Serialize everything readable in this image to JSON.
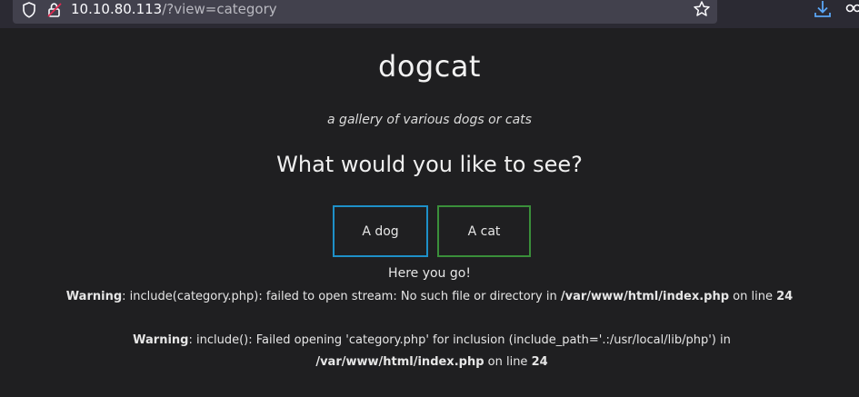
{
  "browser": {
    "url_host": "10.10.80.113",
    "url_path": "/?view=category"
  },
  "page": {
    "title": "dogcat",
    "subtitle": "a gallery of various dogs or cats",
    "question": "What would you like to see?",
    "buttons": {
      "dog": "A dog",
      "cat": "A cat"
    },
    "result_text": "Here you go!",
    "warnings": [
      {
        "label": "Warning",
        "message": ": include(category.php): failed to open stream: No such file or directory in ",
        "file": "/var/www/html/index.php",
        "line_text": " on line ",
        "line": "24"
      },
      {
        "label": "Warning",
        "message": ": include(): Failed opening 'category.php' for inclusion (include_path='.:/usr/local/lib/php') in ",
        "file": "/var/www/html/index.php",
        "line_text": " on line ",
        "line": "24"
      }
    ]
  },
  "colors": {
    "background": "#1f1f21",
    "dog_border": "#1e90c8",
    "cat_border": "#3a8f3a"
  }
}
